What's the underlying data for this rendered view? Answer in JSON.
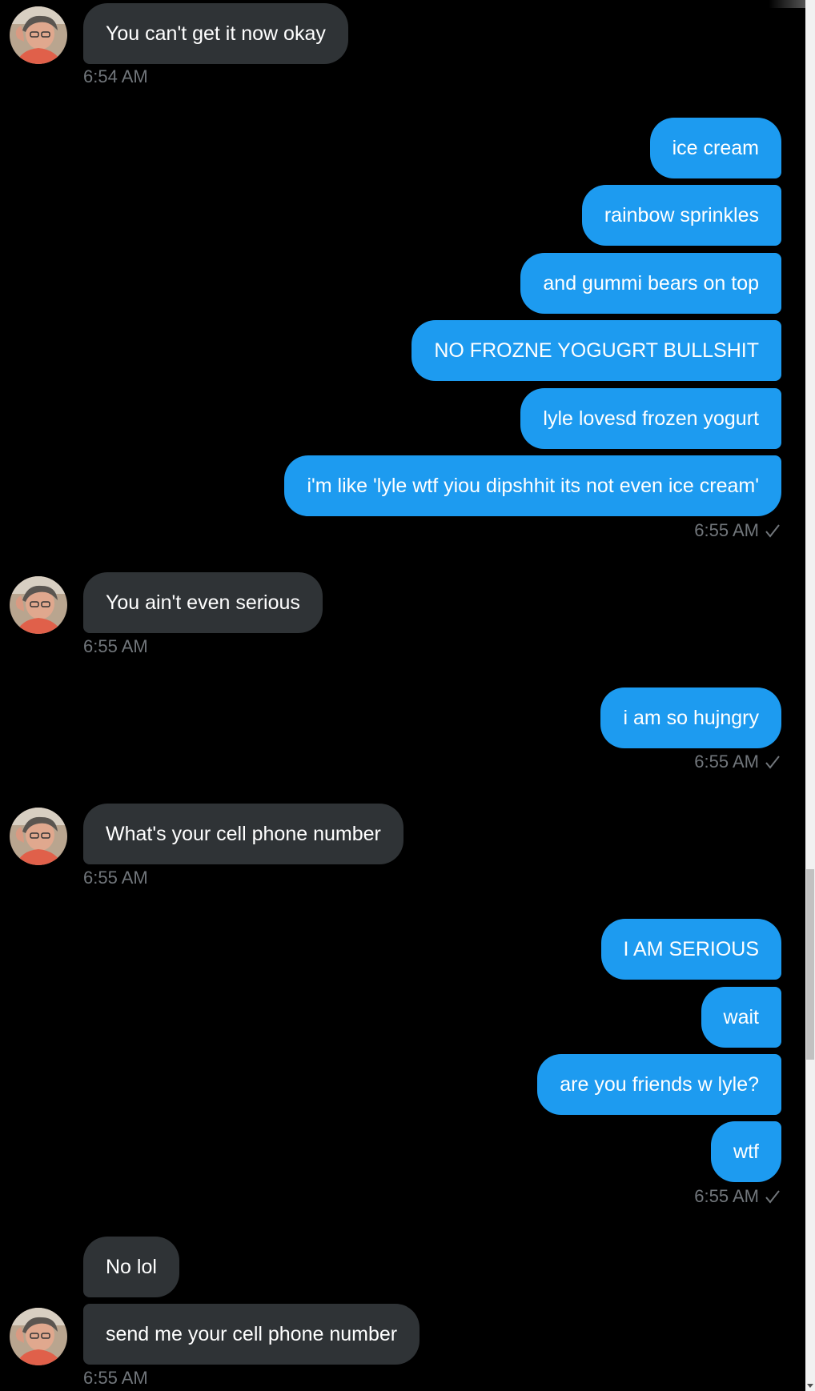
{
  "conversation": {
    "messages": [
      {
        "side": "in",
        "text": "You can't get it now okay"
      },
      {
        "side": "in_time",
        "text": "6:54 AM"
      },
      {
        "side": "out",
        "text": "ice  cream"
      },
      {
        "side": "out",
        "text": "rainbow sprinkles"
      },
      {
        "side": "out",
        "text": "and gummi bears on top"
      },
      {
        "side": "out",
        "text": "NO FROZNE YOGUGRT BULLSHIT"
      },
      {
        "side": "out",
        "text": "lyle lovesd frozen yogurt"
      },
      {
        "side": "out",
        "text": "i'm like 'lyle wtf yiou dipshhit its not even ice cream'"
      },
      {
        "side": "out_time",
        "text": "6:55 AM"
      },
      {
        "side": "in",
        "text": "You ain't even serious"
      },
      {
        "side": "in_time",
        "text": "6:55 AM"
      },
      {
        "side": "out",
        "text": "i am so hujngry"
      },
      {
        "side": "out_time",
        "text": "6:55 AM"
      },
      {
        "side": "in",
        "text": "What's your cell phone number"
      },
      {
        "side": "in_time",
        "text": "6:55 AM"
      },
      {
        "side": "out",
        "text": "I AM SERIOUS"
      },
      {
        "side": "out",
        "text": "wait"
      },
      {
        "side": "out",
        "text": "are you friends w lyle?"
      },
      {
        "side": "out",
        "text": "wtf"
      },
      {
        "side": "out_time",
        "text": "6:55 AM"
      },
      {
        "side": "in",
        "text": "No lol"
      },
      {
        "side": "in",
        "text": "send me your cell phone number"
      },
      {
        "side": "in_time",
        "text": "6:55 AM"
      }
    ]
  },
  "colors": {
    "background": "#000000",
    "incoming_bubble": "#2f3336",
    "outgoing_bubble": "#1d9bf0",
    "timestamp": "#71767b"
  },
  "icons": {
    "read_receipt": "check-icon",
    "avatar": "avatar"
  }
}
